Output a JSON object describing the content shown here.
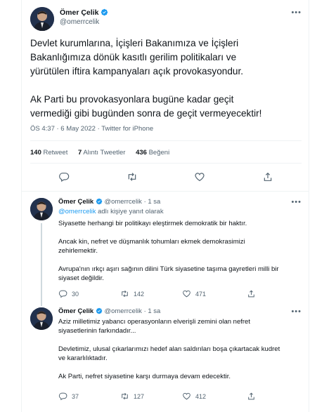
{
  "main_tweet": {
    "author_name": "Ömer Çelik",
    "author_handle": "@omerrcelik",
    "more_icon": "more-horizontal-icon",
    "text_lines_p1": [
      "Devlet kurumlarına, İçişleri Bakanımıza ve İçişleri",
      "Bakanlığımıza dönük kasıtlı gerilim politikaları ve",
      "yürütülen iftira kampanyaları açık provokasyondur."
    ],
    "text_lines_p2": [
      "Ak Parti bu provokasyonlara bugüne kadar geçit",
      "vermediği gibi bugünden sonra de geçit vermeyecektir!"
    ],
    "meta": "ÖS 4:37 · 6 May 2022 · Twitter for iPhone",
    "stats": {
      "retweets_count": "140",
      "retweets_label": "Retweet",
      "quotes_count": "7",
      "quotes_label": "Alıntı Tweetler",
      "likes_count": "436",
      "likes_label": "Beğeni"
    }
  },
  "replies": [
    {
      "author_name": "Ömer Çelik",
      "author_handle": "@omerrcelik",
      "time": "· 1 sa",
      "replying_handle": "@omerrcelik",
      "replying_suffix": "adlı kişiye yanıt olarak",
      "body_paragraphs": [
        [
          "Siyasette herhangi bir politikayı eleştirmek demokratik bir haktır."
        ],
        [
          "Ancak kin, nefret ve düşmanlık tohumları ekmek demokrasimizi",
          "zehirlemektir."
        ],
        [
          "Avrupa'nın ırkçı aşırı sağının dilini Türk siyasetine taşıma gayretleri milli bir",
          "siyaset değildir."
        ]
      ],
      "reply_count": "30",
      "retweet_count": "142",
      "like_count": "471"
    },
    {
      "author_name": "Ömer Çelik",
      "author_handle": "@omerrcelik",
      "time": "· 1 sa",
      "body_paragraphs": [
        [
          "Aziz milletimiz yabancı operasyonların elverişli zemini olan nefret",
          "siyasetlerinin farkındadır..."
        ],
        [
          "Devletimiz, ulusal çıkarlarımızı hedef alan saldırıları boşa çıkartacak kudret",
          "ve kararlılıktadır."
        ],
        [
          "Ak Parti, nefret siyasetine karşı durmaya devam edecektir."
        ]
      ],
      "reply_count": "37",
      "retweet_count": "127",
      "like_count": "412"
    }
  ],
  "colors": {
    "accent": "#1d9bf0",
    "text": "#0f1419",
    "muted": "#536471",
    "divider": "#eff3f4"
  }
}
